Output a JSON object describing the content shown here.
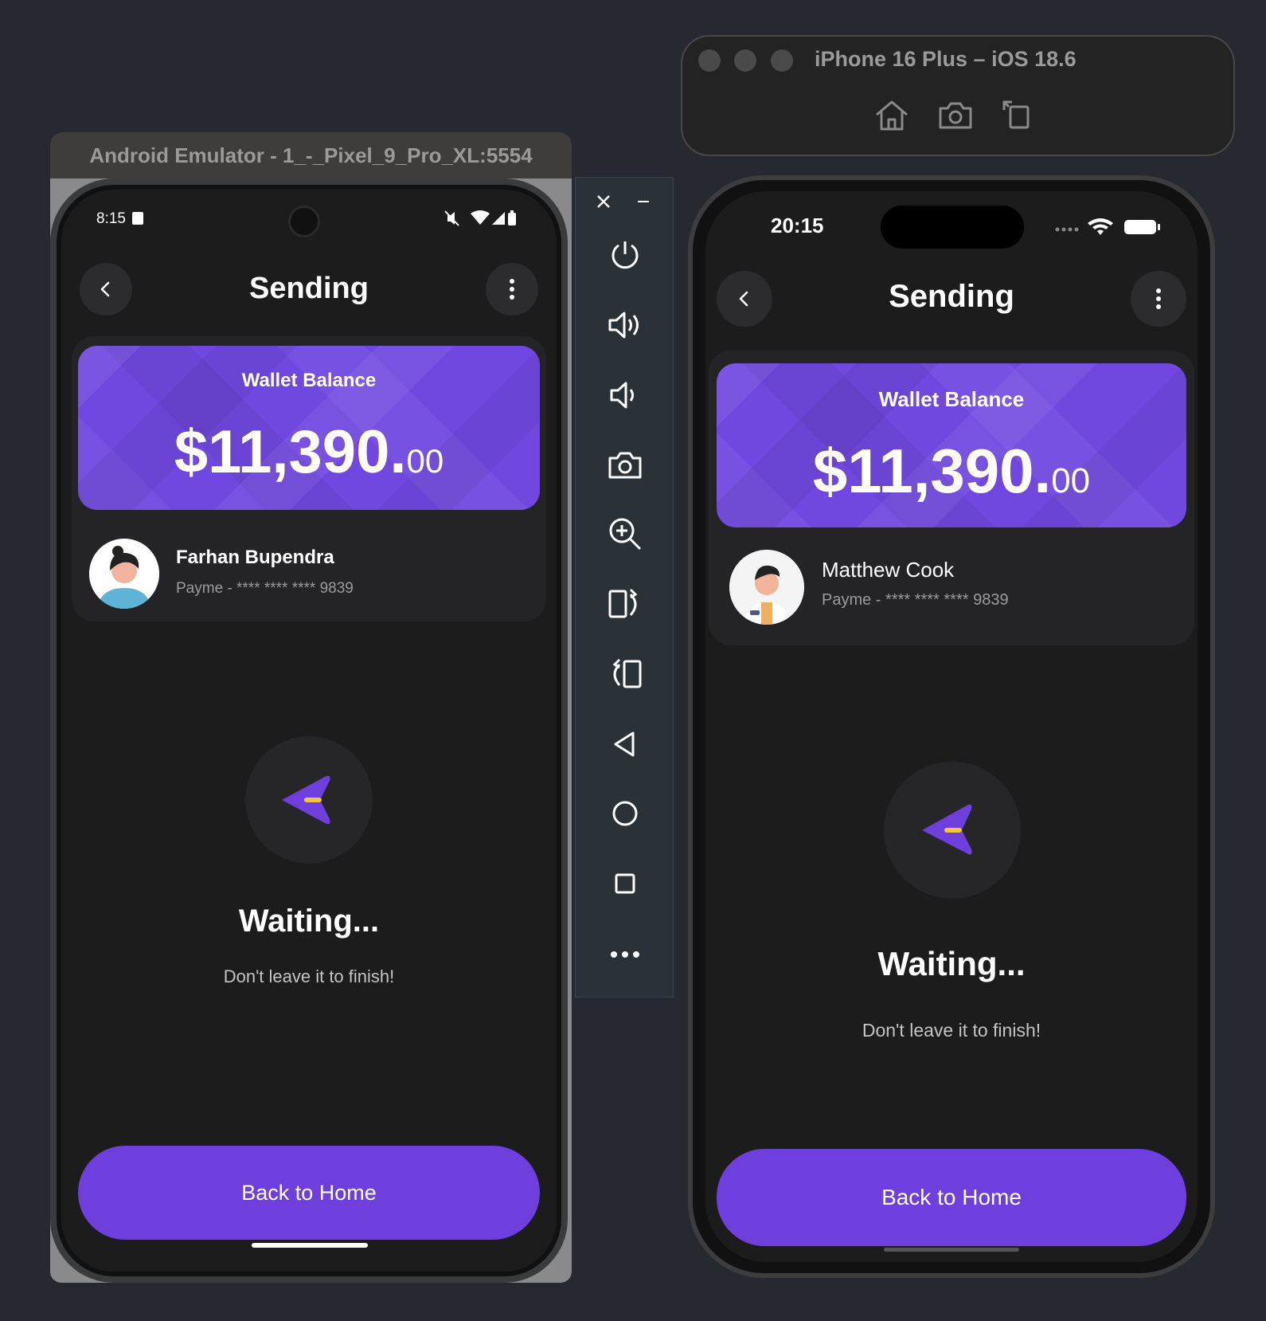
{
  "android": {
    "window_title": "Android Emulator - 1_-_Pixel_9_Pro_XL:5554",
    "status_time": "8:15",
    "title": "Sending",
    "wallet_label": "Wallet Balance",
    "balance_main": "$11,390.",
    "balance_cents": "00",
    "recipient_name": "Farhan Bupendra",
    "recipient_detail": "Payme - **** **** **** 9839",
    "waiting": "Waiting...",
    "subtext": "Don't leave it to finish!",
    "home_button": "Back to Home"
  },
  "ios": {
    "window_title": "iPhone 16 Plus – iOS 18.6",
    "status_time": "20:15",
    "title": "Sending",
    "wallet_label": "Wallet Balance",
    "balance_main": "$11,390.",
    "balance_cents": "00",
    "recipient_name": "Matthew Cook",
    "recipient_detail": "Payme - **** **** **** 9839",
    "waiting": "Waiting...",
    "subtext": "Don't leave it to finish!",
    "home_button": "Back to Home"
  },
  "emulator_toolbar": [
    "close-icon",
    "minimize-icon",
    "power-icon",
    "volume-up-icon",
    "volume-down-icon",
    "camera-icon",
    "zoom-icon",
    "rotate-left-icon",
    "rotate-right-icon",
    "back-icon",
    "home-icon",
    "overview-icon",
    "more-icon"
  ],
  "colors": {
    "accent": "#6e3fdc",
    "card": "#7048e0",
    "background": "#1c1c1d",
    "send_arrow_stripe": "#f5c542"
  }
}
